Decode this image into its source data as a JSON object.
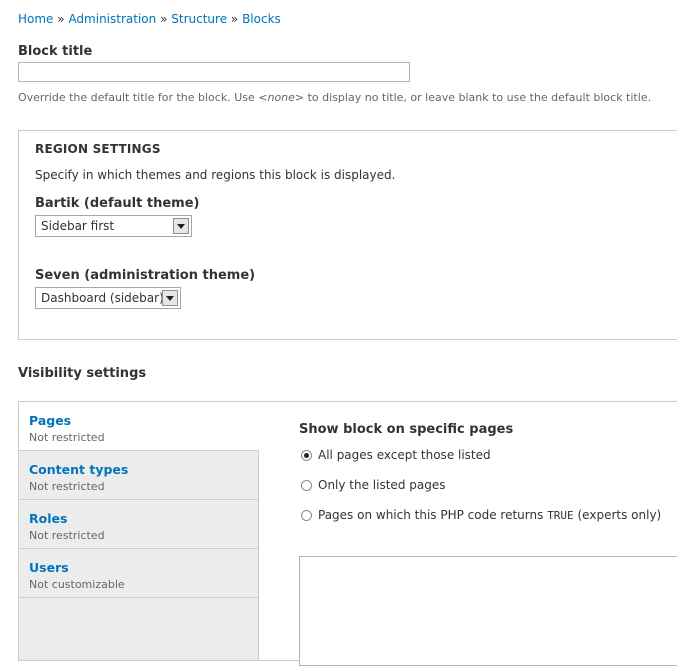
{
  "breadcrumb": {
    "items": [
      "Home",
      "Administration",
      "Structure",
      "Blocks"
    ],
    "separator": "»"
  },
  "block_title": {
    "label": "Block title",
    "value": "",
    "description_before": "Override the default title for the block. Use ",
    "description_code": "<none>",
    "description_after": " to display no title, or leave blank to use the default block title."
  },
  "region_settings": {
    "legend": "REGION SETTINGS",
    "description": "Specify in which themes and regions this block is displayed.",
    "themes": [
      {
        "label": "Bartik (default theme)",
        "selected": "Sidebar first"
      },
      {
        "label": "Seven (administration theme)",
        "selected": "Dashboard (sidebar)"
      }
    ]
  },
  "visibility": {
    "heading": "Visibility settings",
    "tabs": [
      {
        "title": "Pages",
        "summary": "Not restricted",
        "active": true
      },
      {
        "title": "Content types",
        "summary": "Not restricted",
        "active": false
      },
      {
        "title": "Roles",
        "summary": "Not restricted",
        "active": false
      },
      {
        "title": "Users",
        "summary": "Not customizable",
        "active": false
      }
    ],
    "pane": {
      "title": "Show block on specific pages",
      "options": [
        {
          "label": "All pages except those listed",
          "checked": true
        },
        {
          "label": "Only the listed pages",
          "checked": false
        },
        {
          "label_before": "Pages on which this PHP code returns ",
          "label_code": "TRUE",
          "label_after": " (experts only)",
          "checked": false
        }
      ],
      "pages_value": ""
    }
  },
  "colors": {
    "link": "#0074bd",
    "tab_background": "#ececec",
    "border": "#cccccc"
  }
}
